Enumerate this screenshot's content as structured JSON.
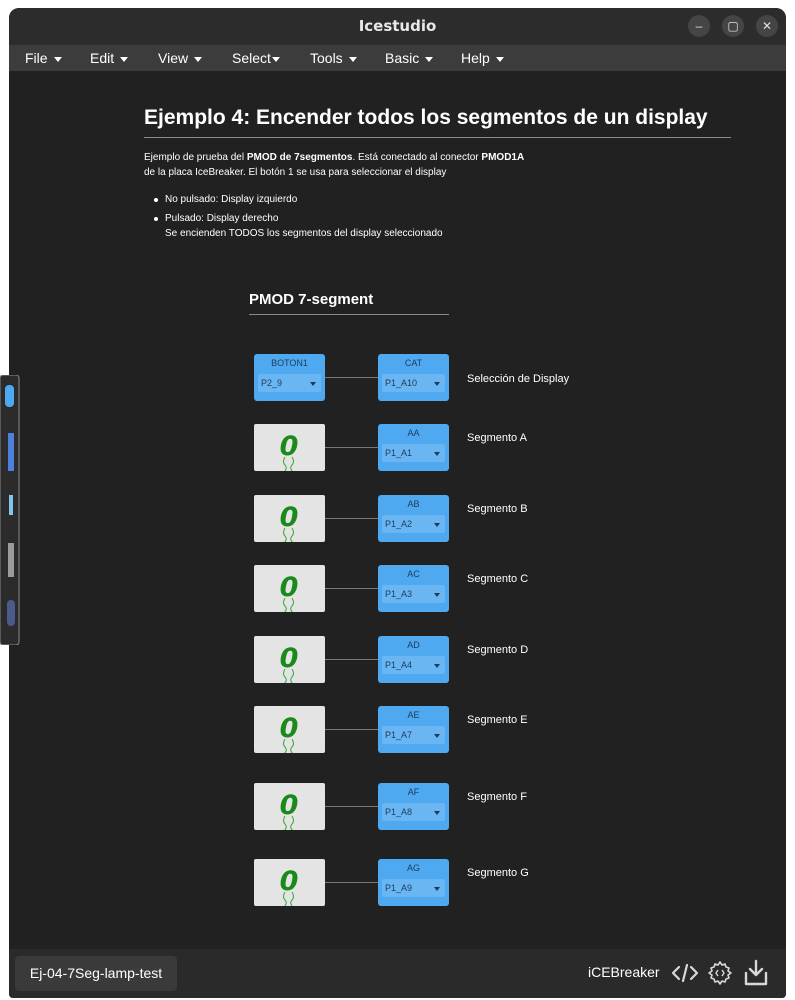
{
  "window": {
    "title": "Icestudio",
    "minimize": "–",
    "maximize": "▢",
    "close": "✕"
  },
  "menu": [
    "File",
    "Edit",
    "View",
    "Select",
    "Tools",
    "Basic",
    "Help"
  ],
  "doc": {
    "heading": "Ejemplo 4: Encender todos los segmentos de un display",
    "p1_a": "Ejemplo de prueba del ",
    "p1_b": "PMOD de 7segmentos",
    "p1_c": ". Está conectado al conector ",
    "p1_d": "PMOD1A",
    "p1_e": "de la placa IceBreaker. El botón 1 se usa para seleccionar el display",
    "bullet1": "No pulsado: Display izquierdo",
    "bullet2": "Pulsado: Display derecho",
    "bullet2b": "Se encienden TODOS los segmentos del display seleccionado",
    "subheading": "PMOD 7-segment"
  },
  "circuit": {
    "input": {
      "name": "BOTON1",
      "pin": "P2_9"
    },
    "outputs": [
      {
        "name": "CAT",
        "pin": "P1_A10",
        "label": "Selección de Display"
      },
      {
        "name": "AA",
        "pin": "P1_A1",
        "label": "Segmento A"
      },
      {
        "name": "AB",
        "pin": "P1_A2",
        "label": "Segmento B"
      },
      {
        "name": "AC",
        "pin": "P1_A3",
        "label": "Segmento C"
      },
      {
        "name": "AD",
        "pin": "P1_A4",
        "label": "Segmento D"
      },
      {
        "name": "AE",
        "pin": "P1_A7",
        "label": "Segmento E"
      },
      {
        "name": "AF",
        "pin": "P1_A8",
        "label": "Segmento F"
      },
      {
        "name": "AG",
        "pin": "P1_A9",
        "label": "Segmento G"
      }
    ],
    "constant_value": "0"
  },
  "status": {
    "file": "Ej-04-7Seg-lamp-test",
    "board": "iCEBreaker"
  },
  "icons": [
    "code-icon",
    "settings-gear-icon",
    "download-icon",
    "lamp-zero-icon"
  ],
  "colors": {
    "block": "#4fa9f1",
    "lamp_digit": "#1a8a1a"
  }
}
